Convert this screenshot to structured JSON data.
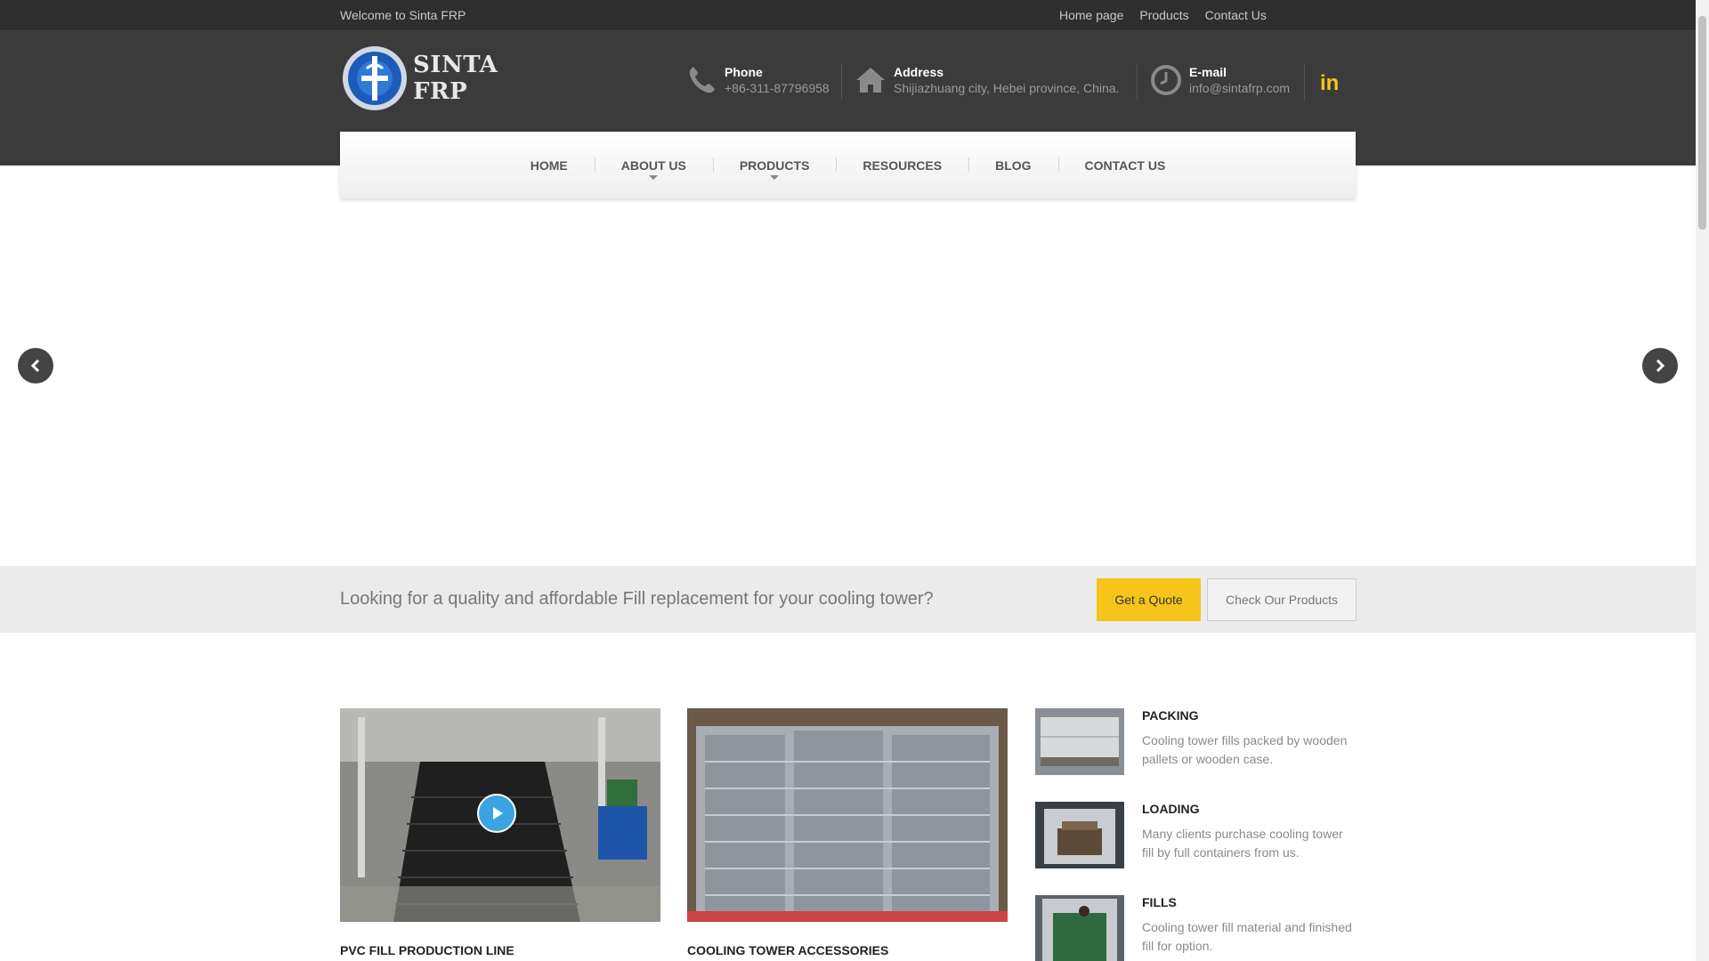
{
  "topbar": {
    "welcome": "Welcome to Sinta FRP",
    "links": [
      "Home page",
      "Products",
      "Contact Us"
    ]
  },
  "header": {
    "logo_text": "SINTA FRP",
    "phone": {
      "label": "Phone",
      "value": "+86-311-87796958",
      "icon": "phone-icon"
    },
    "address": {
      "label": "Address",
      "value": "Shijiazhuang city, Hebei province, China.",
      "icon": "home-icon"
    },
    "email": {
      "label": "E-mail",
      "value": "info@sintafrp.com",
      "icon": "clock-icon"
    },
    "social": {
      "icon": "linkedin-icon",
      "text": "in",
      "color": "#f5c518"
    }
  },
  "nav": {
    "items": [
      "HOME",
      "ABOUT US",
      "PRODUCTS",
      "RESOURCES",
      "BLOG",
      "CONTACT US"
    ]
  },
  "slider": {
    "prev_icon": "chevron-left-icon",
    "next_icon": "chevron-right-icon"
  },
  "banner": {
    "text": "Looking for a quality and affordable Fill replacement for your cooling tower?",
    "quote_button": "Get a Quote",
    "products_button": "Check Our Products",
    "accent": "#f5c518"
  },
  "products": {
    "cards": [
      {
        "title": "PVC FILL PRODUCTION LINE",
        "icon": "play-icon"
      },
      {
        "title": "COOLING TOWER ACCESSORIES"
      }
    ],
    "side": [
      {
        "title": "PACKING",
        "desc": "Cooling tower fills packed by wooden pallets or wooden case."
      },
      {
        "title": "LOADING",
        "desc": "Many clients purchase cooling tower fill by full containers from us."
      },
      {
        "title": "FILLS",
        "desc": "Cooling tower fill material and finished fill for option."
      }
    ]
  }
}
